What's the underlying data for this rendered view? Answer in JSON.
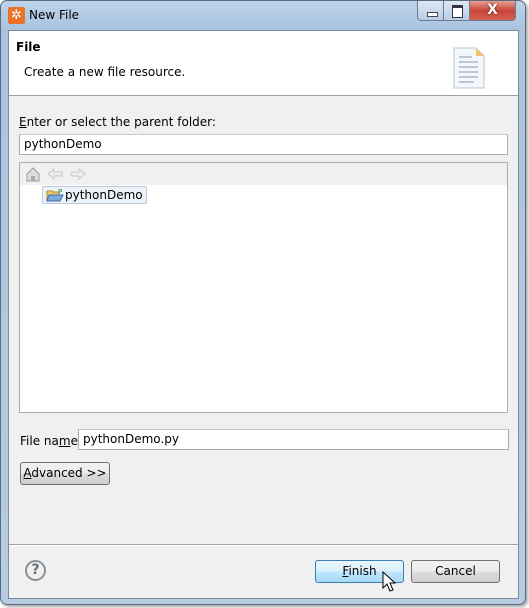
{
  "window": {
    "title": "New File",
    "app_icon": "gear-icon",
    "close_glyph": "X"
  },
  "header": {
    "title": "File",
    "description": "Create a new file resource.",
    "icon": "document-icon"
  },
  "parent_folder": {
    "label_mnemonic": "E",
    "label_rest": "nter or select the parent folder:",
    "value": "pythonDemo"
  },
  "tree": {
    "toolbar": [
      "home-icon",
      "back-icon",
      "forward-icon"
    ],
    "items": [
      {
        "label": "pythonDemo",
        "icon": "python-project-folder-icon"
      }
    ]
  },
  "file_name": {
    "label_pre": "File na",
    "label_mnemonic": "m",
    "label_post": "e:",
    "value": "pythonDemo.py"
  },
  "buttons": {
    "advanced_mnemonic": "A",
    "advanced_rest": "dvanced >>",
    "finish_mnemonic": "F",
    "finish_rest": "inish",
    "cancel": "Cancel",
    "help_glyph": "?"
  },
  "colors": {
    "accent": "#3c7fb1",
    "app_icon": "#e8742a"
  }
}
